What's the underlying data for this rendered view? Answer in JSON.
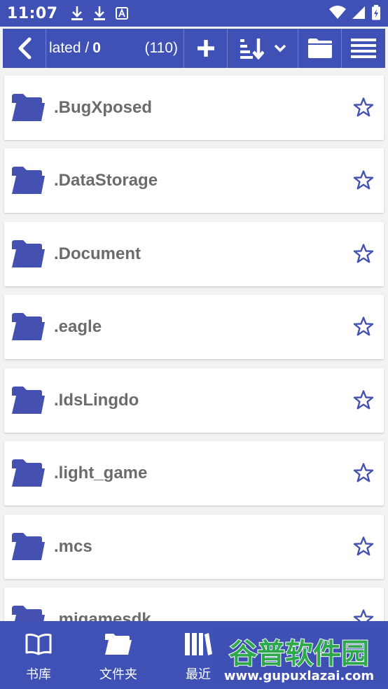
{
  "status_bar": {
    "time": "11:07"
  },
  "toolbar": {
    "path": "lated /",
    "path_zero": "0",
    "count": "(110)"
  },
  "files": [
    {
      "name": ".BugXposed"
    },
    {
      "name": ".DataStorage"
    },
    {
      "name": ".Document"
    },
    {
      "name": ".eagle"
    },
    {
      "name": ".IdsLingdo"
    },
    {
      "name": ".light_game"
    },
    {
      "name": ".mcs"
    },
    {
      "name": ".migamesdk"
    }
  ],
  "bottom_nav": {
    "items": [
      {
        "label": "书库",
        "icon": "book-icon"
      },
      {
        "label": "文件夹",
        "icon": "folder-icon"
      },
      {
        "label": "最近",
        "icon": "books-icon"
      }
    ]
  },
  "watermark": {
    "title": "谷普软件园",
    "url": "www.gupuxlazai.com"
  },
  "colors": {
    "primary": "#3f51b5",
    "folder": "#4451b0",
    "text": "#6b6b6b"
  }
}
